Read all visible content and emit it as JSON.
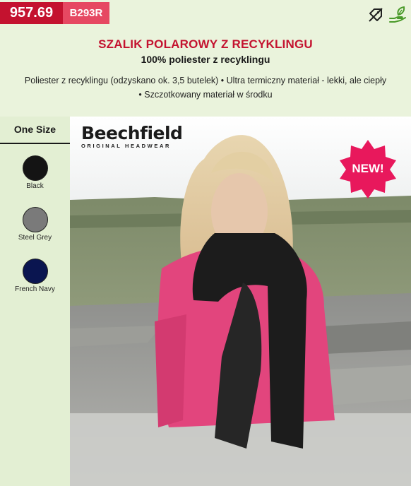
{
  "product": {
    "code": "957.69",
    "ref": "B293R",
    "title": "SZALIK POLAROWY Z RECYKLINGU",
    "subtitle": "100% poliester z recyklingu",
    "description_line1": "Poliester z recyklingu (odzyskano ok. 3,5 butelek) • Ultra termiczny materiał - lekki, ale ciepły",
    "description_line2": "• Szczotkowany materiał w środku",
    "badge": "NEW!"
  },
  "icons": [
    "no-discount-icon",
    "eco-hand-leaf-icon"
  ],
  "brand": {
    "name": "Beechfield",
    "tagline": "ORIGINAL HEADWEAR"
  },
  "size": {
    "label": "One Size"
  },
  "colors": [
    {
      "name": "Black",
      "hex": "#141414"
    },
    {
      "name": "Steel Grey",
      "hex": "#7a7a7a"
    },
    {
      "name": "French Navy",
      "hex": "#0a1550"
    }
  ],
  "theme": {
    "code_red": "#c4122f",
    "ref_pink": "#e64862",
    "header_bg": "#eaf3dc",
    "sidebar_bg": "#e3efd3",
    "badge_pink": "#e8185c",
    "eco_green": "#4a9a2a"
  }
}
